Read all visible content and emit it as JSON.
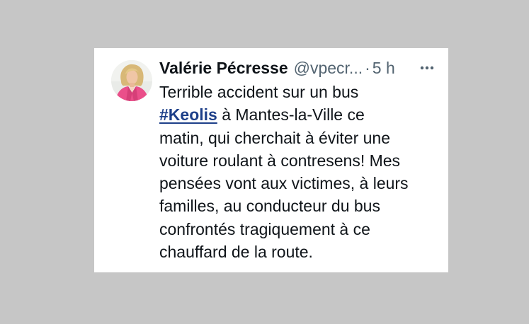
{
  "tweet": {
    "author_name": "Valérie Pécresse",
    "author_handle": "@vpecr...",
    "separator": "·",
    "time": "5 h",
    "avatar_icon": "profile-photo",
    "more_icon": "more-dots-icon",
    "text_lines": [
      {
        "pre": "Terrible accident sur un bus"
      },
      {
        "hashtag": "#Keolis",
        "post": " à Mantes-la-Ville ce"
      },
      {
        "pre": "matin, qui cherchait à éviter une"
      },
      {
        "pre": "voiture roulant à contresens! Mes"
      },
      {
        "pre": "pensées vont aux victimes, à leurs"
      },
      {
        "pre": "familles, au conducteur du bus"
      },
      {
        "pre": "confrontés tragiquement à ce"
      },
      {
        "pre": "chauffard de la route."
      }
    ]
  },
  "colors": {
    "page_background": "#c6c6c6",
    "card_background": "#ffffff",
    "text": "#0f1419",
    "secondary_text": "#536471",
    "hashtag": "#1d3f89"
  }
}
